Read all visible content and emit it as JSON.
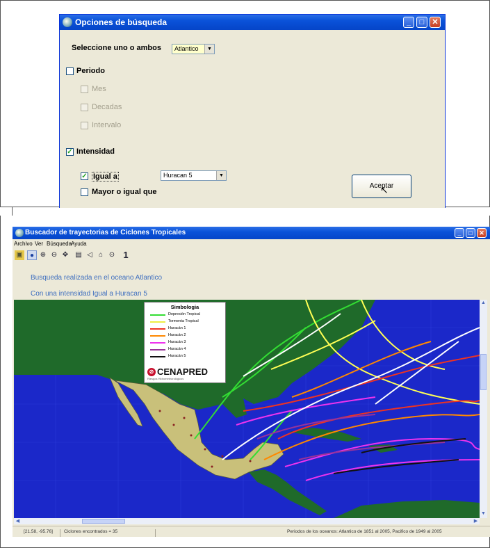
{
  "dialog": {
    "title": "Opciones de búsqueda",
    "select_label": "Seleccione uno o ambos",
    "ocean_value": "Atlantico",
    "periodo": {
      "label": "Periodo",
      "checked": false
    },
    "mes": {
      "label": "Mes"
    },
    "decadas": {
      "label": "Decadas"
    },
    "intervalo": {
      "label": "Intervalo"
    },
    "intensidad": {
      "label": "Intensidad",
      "checked": true
    },
    "igual": {
      "label": "Igual a",
      "checked": true,
      "value": "Huracan 5"
    },
    "mayor": {
      "label": "Mayor o igual que",
      "checked": false
    },
    "accept_label": "Aceptar",
    "check_mark": "✓",
    "arrow": "▼"
  },
  "app": {
    "title": "Buscador de trayectorias de Ciclones Tropicales",
    "menu": [
      "Archivo",
      "Ver",
      "Búsqueda",
      "Ayuda"
    ],
    "toolbar_icons": [
      "save-icon",
      "globe-icon",
      "zoom-in-icon",
      "zoom-out-icon",
      "pan-icon",
      "print-icon",
      "back-icon",
      "clear-icon",
      "target-icon",
      "info-icon"
    ],
    "toolbar_glyph_info": "1",
    "info_line1": "Busqueda realizada en el oceano Atlantico",
    "info_line2": "Con una intensidad  Igual a Huracan 5",
    "legend": {
      "title": "Simbologia",
      "items": [
        {
          "label": "Depresión Tropical",
          "color": "#33dd33"
        },
        {
          "label": "Tormenta Tropical",
          "color": "#ffff55"
        },
        {
          "label": "Huracán 1",
          "color": "#ee3322"
        },
        {
          "label": "Huracán 2",
          "color": "#ff8800"
        },
        {
          "label": "Huracán 3",
          "color": "#ee33ee"
        },
        {
          "label": "Huracán 4",
          "color": "#993399"
        },
        {
          "label": "Huracán 5",
          "color": "#111111"
        }
      ],
      "logo_name": "CENAPRED",
      "logo_tagline": "Riesgos Hidrometeorológicos"
    },
    "status": {
      "coords": "[21.58, -95.76]",
      "count": "Ciclones encontrados = 35",
      "periods": "Periodos de los oceanos: Atlantico de 1851 al 2005, Pacifico de 1949 al 2005"
    }
  }
}
